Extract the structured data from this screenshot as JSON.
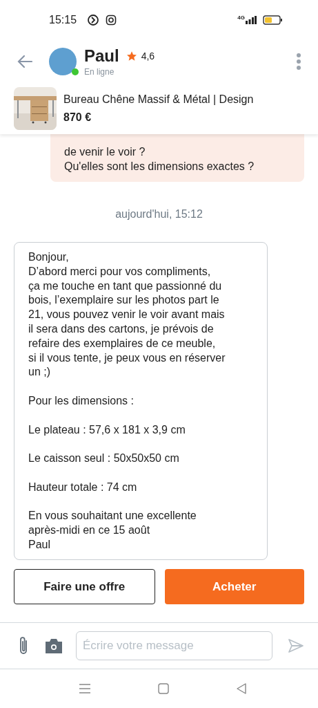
{
  "status_bar": {
    "time": "15:15",
    "network": "4G"
  },
  "header": {
    "name": "Paul",
    "rating": "4,6",
    "status": "En ligne",
    "online": true
  },
  "listing": {
    "title": "Bureau Chêne Massif & Métal | Design",
    "price": "870 €"
  },
  "messages": [
    {
      "kind": "sent",
      "text": "de venir le voir ?\nQu'elles sont les dimensions exactes ?"
    },
    {
      "kind": "date",
      "text": "aujourd'hui, 15:12"
    },
    {
      "kind": "received",
      "text": "Bonjour,\nD’abord merci pour vos compliments,\nça me touche en tant que passionné du\nbois, l’exemplaire sur les photos part le\n21, vous pouvez venir le voir avant mais\nil sera dans des cartons, je prévois de\nrefaire des exemplaires de ce meuble,\nsi il vous tente, je peux vous en réserver\nun ;)\n\nPour les dimensions :\n\nLe plateau : 57,6 x 181 x 3,9 cm\n\nLe caisson seul : 50x50x50 cm\n\nHauteur totale : 74 cm\n\nEn vous souhaitant une excellente\naprès-midi en ce 15 août\nPaul"
    }
  ],
  "actions": [
    {
      "label": "Faire une offre",
      "kind": "secondary"
    },
    {
      "label": "Acheter",
      "kind": "primary"
    }
  ],
  "composer": {
    "placeholder": "Écrire votre message"
  }
}
